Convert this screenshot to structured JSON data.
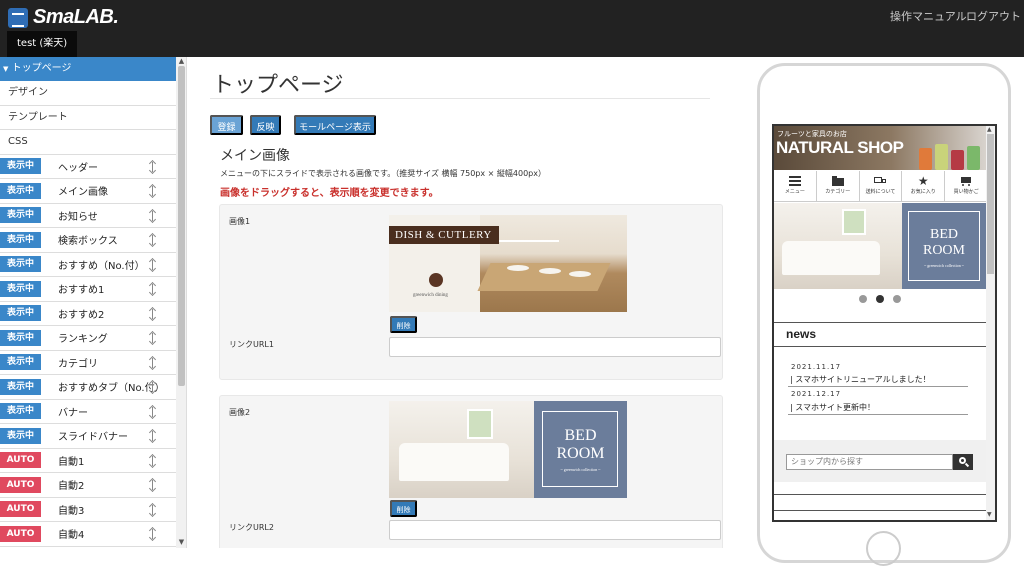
{
  "app": {
    "logo_text": "SmaLAB.",
    "shop_tab": "test (楽天)"
  },
  "header_links": {
    "manual": "操作マニュアル",
    "logout": "ログアウト"
  },
  "sidebar": {
    "head": "トップページ",
    "plain_items": [
      "デザイン",
      "テンプレート",
      "CSS"
    ],
    "rows": [
      {
        "status": "表示中",
        "label": "ヘッダー",
        "kind": "on"
      },
      {
        "status": "表示中",
        "label": "メイン画像",
        "kind": "on"
      },
      {
        "status": "表示中",
        "label": "お知らせ",
        "kind": "on"
      },
      {
        "status": "表示中",
        "label": "検索ボックス",
        "kind": "on"
      },
      {
        "status": "表示中",
        "label": "おすすめ（No.付）",
        "kind": "on"
      },
      {
        "status": "表示中",
        "label": "おすすめ1",
        "kind": "on"
      },
      {
        "status": "表示中",
        "label": "おすすめ2",
        "kind": "on"
      },
      {
        "status": "表示中",
        "label": "ランキング",
        "kind": "on"
      },
      {
        "status": "表示中",
        "label": "カテゴリ",
        "kind": "on"
      },
      {
        "status": "表示中",
        "label": "おすすめタブ（No.付）",
        "kind": "on"
      },
      {
        "status": "表示中",
        "label": "バナー",
        "kind": "on"
      },
      {
        "status": "表示中",
        "label": "スライドバナー",
        "kind": "on"
      },
      {
        "status": "AUTO",
        "label": "自動1",
        "kind": "auto"
      },
      {
        "status": "AUTO",
        "label": "自動2",
        "kind": "auto"
      },
      {
        "status": "AUTO",
        "label": "自動3",
        "kind": "auto"
      },
      {
        "status": "AUTO",
        "label": "自動4",
        "kind": "auto"
      }
    ]
  },
  "main": {
    "title": "トップページ",
    "buttons": {
      "register": "登録",
      "apply": "反映",
      "mall_view": "モールページ表示"
    },
    "section_title": "メイン画像",
    "section_desc": "メニューの下にスライドで表示される画像です。（推奨サイズ 横幅 750px × 縦幅400px）",
    "section_warn": "画像をドラッグすると、表示順を変更できます。",
    "cards": [
      {
        "label": "画像1",
        "delete": "削除",
        "url_label": "リンクURL1",
        "url_value": "",
        "banner_title": "DISH & CUTLERY",
        "banner_sub": "greenwich dining"
      },
      {
        "label": "画像2",
        "delete": "削除",
        "url_label": "リンクURL2",
        "url_value": "",
        "banner_title1": "BED",
        "banner_title2": "ROOM",
        "banner_sub": "~ greenwich collection ~"
      }
    ]
  },
  "preview": {
    "shop_sub": "フルーツと家具のお店",
    "shop_name": "NATURAL SHOP",
    "nav": [
      "メニュー",
      "カテゴリー",
      "送料について",
      "お気に入り",
      "買い物かご"
    ],
    "slide_title1": "BED",
    "slide_title2": "ROOM",
    "slide_sub": "~ greenwich collection ~",
    "news_title": "news",
    "news": [
      {
        "date": "2021.11.17",
        "text": "| スマホサイトリニューアルしました！"
      },
      {
        "date": "2021.12.17",
        "text": "| スマホサイト更新中！"
      }
    ],
    "search_placeholder": "ショップ内から探す"
  },
  "colors": {
    "accent": "#3a87c9",
    "auto": "#e0495f",
    "warn": "#c9302c",
    "topbar": "#222222"
  }
}
